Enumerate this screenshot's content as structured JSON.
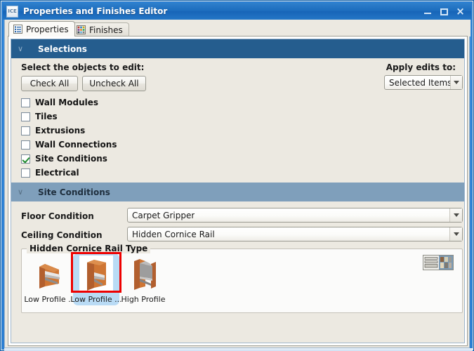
{
  "window": {
    "app_icon_text": "ICE",
    "title": "Properties and Finishes Editor",
    "buttons": {
      "minimize": "minimize-button",
      "maximize": "maximize-button",
      "close": "×"
    }
  },
  "tabs": [
    {
      "label": "Properties",
      "icon": "list-icon",
      "active": true
    },
    {
      "label": "Finishes",
      "icon": "palette-grid-icon",
      "active": false
    }
  ],
  "selections_section": {
    "header": "Selections",
    "chevron": "∨",
    "instruction": "Select the objects to edit:",
    "check_all_label": "Check All",
    "uncheck_all_label": "Uncheck All",
    "apply_edits_label": "Apply edits to:",
    "apply_edits_value": "Selected Items",
    "items": [
      {
        "label": "Wall Modules",
        "checked": false
      },
      {
        "label": "Tiles",
        "checked": false
      },
      {
        "label": "Extrusions",
        "checked": false
      },
      {
        "label": "Wall Connections",
        "checked": false
      },
      {
        "label": "Site Conditions",
        "checked": true
      },
      {
        "label": "Electrical",
        "checked": false
      }
    ]
  },
  "site_conditions_section": {
    "header": "Site Conditions",
    "chevron": "∨",
    "floor_condition_label": "Floor Condition",
    "floor_condition_value": "Carpet Gripper",
    "ceiling_condition_label": "Ceiling Condition",
    "ceiling_condition_value": "Hidden Cornice Rail",
    "group_title": "Hidden Cornice Rail Type",
    "thumbnails": [
      {
        "label": "Low Profile ...",
        "selected": false
      },
      {
        "label": "Low Profile ...",
        "selected": true
      },
      {
        "label": "High Profile",
        "selected": false
      }
    ],
    "view_toggle_icon": "list-grid-view-toggle-icon"
  },
  "colors": {
    "titlebar_blue": "#1c6cbd",
    "section_dark": "#255d8e",
    "section_light": "#7f9fbb",
    "panel_bg": "#ece9e1",
    "selection_highlight": "#b9dbf5",
    "selection_ring": "#ee0000",
    "check_green": "#1f8b2d"
  }
}
